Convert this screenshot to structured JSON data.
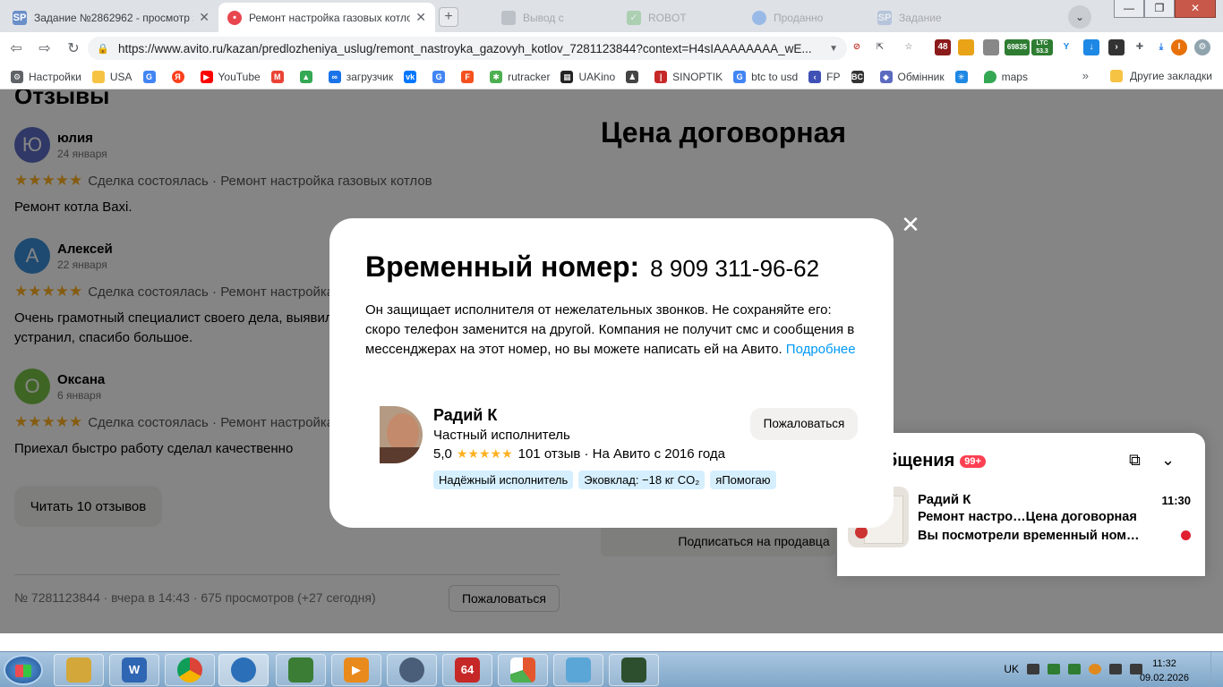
{
  "browser": {
    "tabs": [
      {
        "label": "Задание №2862962 - просмотр з",
        "favicon": "SP",
        "color": "#6b8fc9"
      },
      {
        "label": "Ремонт настройка газовых котло",
        "favicon": "avito",
        "color": "#e8464f"
      },
      {
        "label": "Вывод с",
        "favicon": "doc",
        "color": "#7e8792"
      },
      {
        "label": "ROBOT",
        "favicon": "check",
        "color": "#4caf50"
      },
      {
        "label": "Проданно",
        "favicon": "dot",
        "color": "#1a73e8"
      },
      {
        "label": "Задание",
        "favicon": "SP",
        "color": "#6b8fc9"
      }
    ],
    "url": "https://www.avito.ru/kazan/predlozheniya_uslug/remont_nastroyka_gazovyh_kotlov_7281123844?context=H4sIAAAAAAAA_wE...",
    "extensions": [
      {
        "name": "ext-48",
        "text": "48",
        "color": "#8b1a1a"
      },
      {
        "name": "ext-shield",
        "text": "",
        "color": "#e8a317"
      },
      {
        "name": "ext-briefcase",
        "text": "",
        "color": "#777"
      },
      {
        "name": "ext-btc",
        "text": "69835",
        "color": "#2e7d32"
      },
      {
        "name": "ext-ltc",
        "text": "LTC 53.3",
        "color": "#2e7d32"
      }
    ]
  },
  "bookmarks": [
    {
      "label": "Настройки",
      "icon": "gear-icon",
      "color": "#5f6368"
    },
    {
      "label": "USA",
      "icon": "folder-icon",
      "color": "#f6c343"
    },
    {
      "label": "",
      "icon": "google-icon",
      "color": "#4285f4"
    },
    {
      "label": "",
      "icon": "yandex-icon",
      "color": "#fc3f1d"
    },
    {
      "label": "YouTube",
      "icon": "youtube-icon",
      "color": "#ff0000"
    },
    {
      "label": "",
      "icon": "gmail-icon",
      "color": "#ea4335"
    },
    {
      "label": "",
      "icon": "drive-icon",
      "color": "#34a853"
    },
    {
      "label": "загрузчик",
      "icon": "link-icon",
      "color": "#1a73e8"
    },
    {
      "label": "",
      "icon": "vk-icon",
      "color": "#0077ff"
    },
    {
      "label": "",
      "icon": "translate-icon",
      "color": "#4285f4"
    },
    {
      "label": "",
      "icon": "f-icon",
      "color": "#f4511e"
    },
    {
      "label": "rutracker",
      "icon": "star-icon",
      "color": "#4caf50"
    },
    {
      "label": "UAKino",
      "icon": "film-icon",
      "color": "#222"
    },
    {
      "label": "",
      "icon": "person-icon",
      "color": "#444"
    },
    {
      "label": "SINOPTIK",
      "icon": "thermo-icon",
      "color": "#c62828"
    },
    {
      "label": "btc to usd",
      "icon": "google-icon",
      "color": "#4285f4"
    },
    {
      "label": "FP",
      "icon": "arrow-icon",
      "color": "#3f51b5"
    },
    {
      "label": "",
      "icon": "bc-icon",
      "color": "#333"
    },
    {
      "label": "Обмінник",
      "icon": "exchange-icon",
      "color": "#5c6bc0"
    },
    {
      "label": "",
      "icon": "asterisk-icon",
      "color": "#1e88e5"
    },
    {
      "label": "maps",
      "icon": "maps-icon",
      "color": "#34a853"
    }
  ],
  "bookmarks_more": "»",
  "bookmarks_other": "Другие закладки",
  "page": {
    "reviews_title": "Отзывы",
    "reviews": [
      {
        "initial": "Ю",
        "name": "юлия",
        "date": "24 января",
        "avatar_color": "#5a6bc4",
        "meta": "Сделка состоялась · Ремонт настройка газовых котлов",
        "text": "Ремонт котла Baxi."
      },
      {
        "initial": "А",
        "name": "Алексей",
        "date": "22 января",
        "avatar_color": "#3a8fd9",
        "meta": "Сделка состоялась · Ремонт настройка газовых котлов",
        "text": "Очень грамотный специалист своего дела, выявил проблему и устранил, спасибо большое."
      },
      {
        "initial": "О",
        "name": "Оксана",
        "date": "6 января",
        "avatar_color": "#79c247",
        "meta": "Сделка состоялась · Ремонт настройка газовых котлов",
        "text": "Приехал быстро работу сделал качественно"
      }
    ],
    "stars": "★★★★★",
    "read_reviews": "Читать 10 отзывов",
    "footer_meta": "№ 7281123844 · вчера в 14:43 · 675 просмотров (+27 сегодня)",
    "report_button": "Пожаловаться",
    "price": "Цена договорная",
    "subscribe": "Подписаться на продавца"
  },
  "messages": {
    "title": "Сообщения",
    "badge": "99+",
    "name": "Радий К",
    "time": "11:30",
    "line1": "Ремонт настро…Цена договорная",
    "line2": "Вы посмотрели временный ном…"
  },
  "modal": {
    "title": "Временный номер:",
    "number": "8 909 311-96-62",
    "text": "Он защищает исполнителя от нежелательных звонков. Не сохраняйте его: скоро телефон заменится на другой. Компания не получит смс и сообщения в мессенджерах на этот номер, но вы можете написать ей на Авито.",
    "link": "Подробнее",
    "seller_name": "Радий К",
    "seller_role": "Частный исполнитель",
    "rating": "5,0",
    "rating_info": "101 отзыв · На Авито с 2016 года",
    "tags": [
      "Надёжный исполнитель",
      "Эковклад: −18 кг CO₂",
      "яПомогаю"
    ],
    "report": "Пожаловаться",
    "close": "✕"
  },
  "taskbar": {
    "items": [
      {
        "name": "explorer",
        "color": "#d4a73a",
        "text": ""
      },
      {
        "name": "shield-app",
        "color": "#2f66b3",
        "text": "W"
      },
      {
        "name": "chrome",
        "color": "#db4437",
        "text": ""
      },
      {
        "name": "globe-app",
        "color": "#2a6fb8",
        "text": ""
      },
      {
        "name": "calc-app",
        "color": "#3b7d35",
        "text": ""
      },
      {
        "name": "media-app",
        "color": "#e98a1c",
        "text": "▶"
      },
      {
        "name": "clock-app",
        "color": "#4a5e7a",
        "text": ""
      },
      {
        "name": "aida64",
        "color": "#c62828",
        "text": "64"
      },
      {
        "name": "paint-app",
        "color": "#e4572e",
        "text": ""
      },
      {
        "name": "notepad-app",
        "color": "#5aa6d6",
        "text": ""
      },
      {
        "name": "terminal-app",
        "color": "#2d4f2d",
        "text": ""
      }
    ],
    "lang": "UK",
    "time": "11:32",
    "date": "09.02.2026"
  }
}
